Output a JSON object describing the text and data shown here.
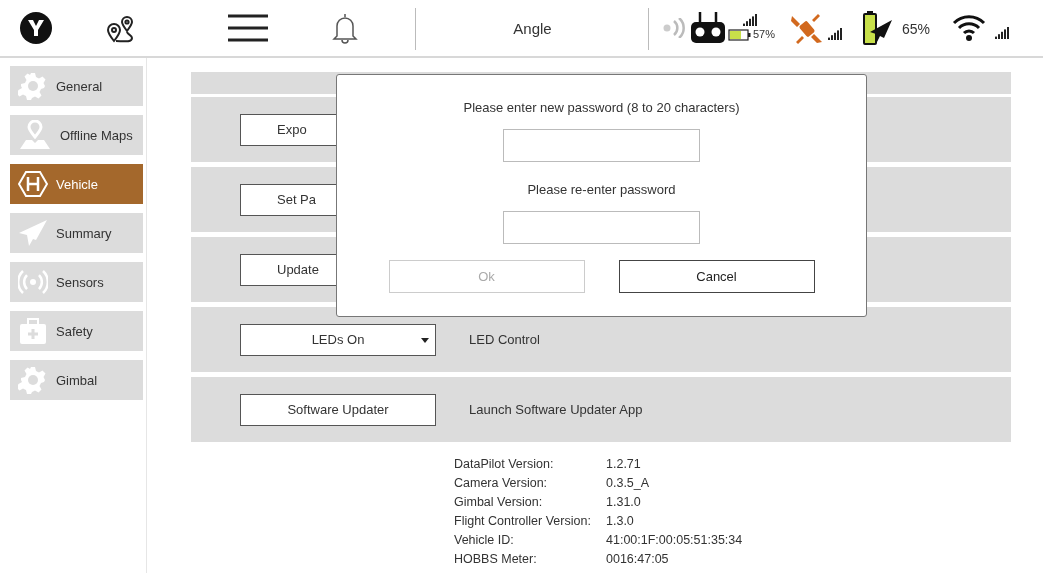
{
  "top_bar": {
    "title": "Angle",
    "controller_battery": "57%",
    "drone_battery": "65%"
  },
  "sidebar": {
    "items": [
      {
        "label": "General",
        "kind": "gear",
        "selected": false
      },
      {
        "label": "Offline Maps",
        "kind": "map-pin",
        "selected": false
      },
      {
        "label": "Vehicle",
        "kind": "helipad",
        "selected": true
      },
      {
        "label": "Summary",
        "kind": "plane",
        "selected": false
      },
      {
        "label": "Sensors",
        "kind": "sensor",
        "selected": false
      },
      {
        "label": "Safety",
        "kind": "kit",
        "selected": false
      },
      {
        "label": "Gimbal",
        "kind": "gear",
        "selected": false
      }
    ]
  },
  "settings_rows": [
    {
      "kind": "partial-button",
      "button": "Expo"
    },
    {
      "kind": "partial-button",
      "button": "Set Pa"
    },
    {
      "kind": "partial-button",
      "button": "Update"
    },
    {
      "kind": "dropdown",
      "button": "LEDs On",
      "description": "LED Control"
    },
    {
      "kind": "button",
      "button": "Software Updater",
      "description": "Launch Software Updater App"
    }
  ],
  "info": [
    {
      "label": "DataPilot Version:",
      "value": "1.2.71"
    },
    {
      "label": "Camera Version:",
      "value": "0.3.5_A"
    },
    {
      "label": "Gimbal Version:",
      "value": "1.31.0"
    },
    {
      "label": "Flight Controller Version:",
      "value": "1.3.0"
    },
    {
      "label": "Vehicle ID:",
      "value": "41:00:1F:00:05:51:35:34"
    },
    {
      "label": "HOBBS Meter:",
      "value": "0016:47:05"
    }
  ],
  "dialog": {
    "prompt": "Please enter new password (8 to 20 characters)",
    "confirm_prompt": "Please re-enter password",
    "buttons": [
      {
        "label": "Ok",
        "disabled": true
      },
      {
        "label": "Cancel",
        "disabled": false
      }
    ]
  }
}
